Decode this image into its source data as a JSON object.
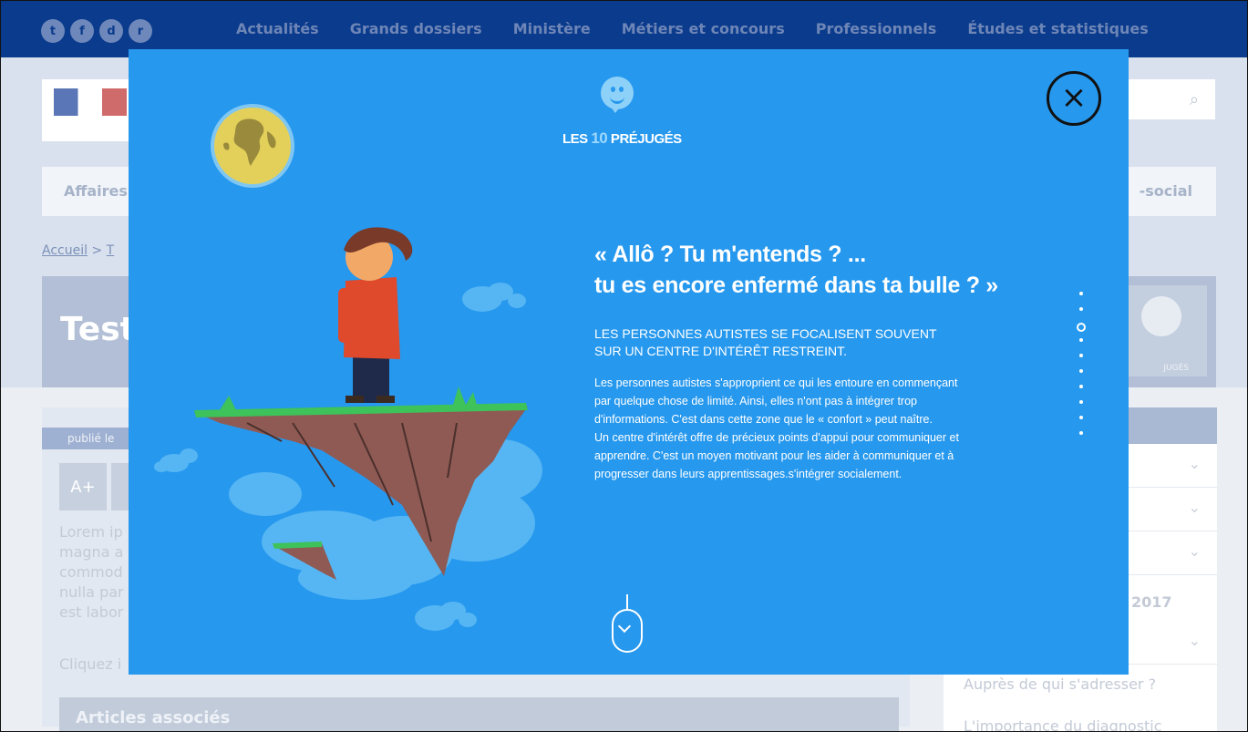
{
  "background": {
    "social_icons": [
      "twitter-icon",
      "facebook-icon",
      "dailymotion-icon",
      "rss-icon"
    ],
    "social_glyphs": [
      "t",
      "f",
      "d",
      "r"
    ],
    "top_nav": [
      "Actualités",
      "Grands dossiers",
      "Ministère",
      "Métiers et concours",
      "Professionnels",
      "Études et statistiques"
    ],
    "nav_left": "Affaires",
    "nav_right": "-social",
    "breadcrumb_home": "Accueil",
    "breadcrumb_sep": " > ",
    "breadcrumb_next": "T",
    "hero_title": "Test",
    "hero_badge_text": "JUGÉS",
    "published": "publié le",
    "font_plus": "A+",
    "lorem_lines": [
      "Lorem ip",
      "magna a",
      "commod",
      "nulla par",
      "est labor"
    ],
    "click_here": "Cliquez i",
    "related_articles": "Articles associés",
    "sidebar_year": "2017",
    "sidebar_link_1": "Auprès de qui s'adresser ?",
    "sidebar_link_2": "L'importance du diagnostic"
  },
  "modal": {
    "brand_prefix": "LES ",
    "brand_number": "10",
    "brand_suffix": " PRÉJUGÉS",
    "close_label": "×",
    "quote_line_1": "« Allô ? Tu m'entends ? ...",
    "quote_line_2": "tu es encore enfermé dans ta bulle ? »",
    "subhead_line_1": "LES PERSONNES AUTISTES SE FOCALISENT SOUVENT",
    "subhead_line_2": "SUR UN CENTRE D'INTÉRÊT RESTREINT.",
    "body_lines": [
      "Les personnes autistes s'approprient ce qui les entoure en commençant",
      "par quelque chose de limité. Ainsi, elles n'ont pas à intégrer trop",
      "d'informations. C'est dans cette zone que le « confort » peut naître.",
      "Un centre d'intérêt offre de précieux points d'appui pour communiquer et",
      "apprendre. C'est un moyen motivant pour les aider à communiquer et à",
      "progresser dans leurs apprentissages.s'intégrer socialement."
    ],
    "pagination_total": 10,
    "pagination_active_index": 2
  },
  "colors": {
    "modal_bg": "#2698ee",
    "page_nav": "#0b3b8c",
    "cloud": "#56b6f3",
    "rock": "#8f5a54",
    "grass": "#3ec25a"
  }
}
